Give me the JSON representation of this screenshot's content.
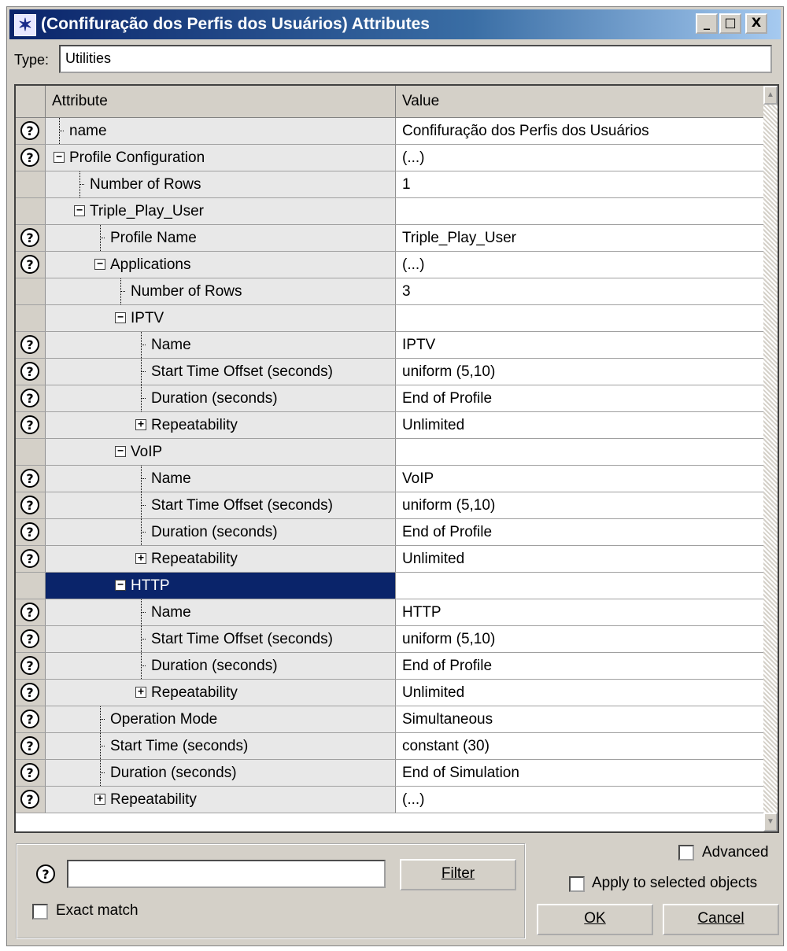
{
  "window": {
    "title": "(Confifuração dos Perfis dos Usuários) Attributes",
    "min_btn": "_",
    "max_btn": "□",
    "close_btn": "X"
  },
  "type": {
    "label": "Type:",
    "value": "Utilities"
  },
  "table": {
    "header_attribute": "Attribute",
    "header_value": "Value",
    "rows": [
      {
        "help": true,
        "depth": 0,
        "toggle": "",
        "attribute": "name",
        "value": "Confifuração dos Perfis dos Usuários"
      },
      {
        "help": true,
        "depth": 0,
        "toggle": "−",
        "attribute": "Profile Configuration",
        "value": "(...)"
      },
      {
        "help": false,
        "depth": 1,
        "toggle": "",
        "attribute": "Number of Rows",
        "value": "1"
      },
      {
        "help": false,
        "depth": 1,
        "toggle": "−",
        "attribute": "Triple_Play_User",
        "value": ""
      },
      {
        "help": true,
        "depth": 2,
        "toggle": "",
        "attribute": "Profile Name",
        "value": "Triple_Play_User"
      },
      {
        "help": true,
        "depth": 2,
        "toggle": "−",
        "attribute": "Applications",
        "value": "(...)"
      },
      {
        "help": false,
        "depth": 3,
        "toggle": "",
        "attribute": "Number of Rows",
        "value": "3"
      },
      {
        "help": false,
        "depth": 3,
        "toggle": "−",
        "attribute": "IPTV",
        "value": ""
      },
      {
        "help": true,
        "depth": 4,
        "toggle": "",
        "attribute": "Name",
        "value": "IPTV"
      },
      {
        "help": true,
        "depth": 4,
        "toggle": "",
        "attribute": "Start Time Offset (seconds)",
        "value": "uniform (5,10)"
      },
      {
        "help": true,
        "depth": 4,
        "toggle": "",
        "attribute": "Duration (seconds)",
        "value": "End of Profile"
      },
      {
        "help": true,
        "depth": 4,
        "toggle": "+",
        "attribute": "Repeatability",
        "value": "Unlimited"
      },
      {
        "help": false,
        "depth": 3,
        "toggle": "−",
        "attribute": "VoIP",
        "value": ""
      },
      {
        "help": true,
        "depth": 4,
        "toggle": "",
        "attribute": "Name",
        "value": "VoIP"
      },
      {
        "help": true,
        "depth": 4,
        "toggle": "",
        "attribute": "Start Time Offset (seconds)",
        "value": "uniform (5,10)"
      },
      {
        "help": true,
        "depth": 4,
        "toggle": "",
        "attribute": "Duration (seconds)",
        "value": "End of Profile"
      },
      {
        "help": true,
        "depth": 4,
        "toggle": "+",
        "attribute": "Repeatability",
        "value": "Unlimited"
      },
      {
        "help": false,
        "depth": 3,
        "toggle": "−",
        "attribute": "HTTP",
        "value": "",
        "selected": true
      },
      {
        "help": true,
        "depth": 4,
        "toggle": "",
        "attribute": "Name",
        "value": "HTTP"
      },
      {
        "help": true,
        "depth": 4,
        "toggle": "",
        "attribute": "Start Time Offset (seconds)",
        "value": "uniform (5,10)"
      },
      {
        "help": true,
        "depth": 4,
        "toggle": "",
        "attribute": "Duration (seconds)",
        "value": "End of Profile"
      },
      {
        "help": true,
        "depth": 4,
        "toggle": "+",
        "attribute": "Repeatability",
        "value": "Unlimited"
      },
      {
        "help": true,
        "depth": 2,
        "toggle": "",
        "attribute": "Operation Mode",
        "value": "Simultaneous"
      },
      {
        "help": true,
        "depth": 2,
        "toggle": "",
        "attribute": "Start Time (seconds)",
        "value": "constant (30)"
      },
      {
        "help": true,
        "depth": 2,
        "toggle": "",
        "attribute": "Duration (seconds)",
        "value": "End of Simulation"
      },
      {
        "help": true,
        "depth": 2,
        "toggle": "+",
        "attribute": "Repeatability",
        "value": "(...)"
      }
    ]
  },
  "filter": {
    "input_value": "",
    "button": "Filter",
    "exact_match": "Exact match"
  },
  "options": {
    "advanced": "Advanced",
    "apply_selected": "Apply to selected objects"
  },
  "buttons": {
    "ok": "OK",
    "cancel": "Cancel"
  },
  "help_glyph": "?"
}
